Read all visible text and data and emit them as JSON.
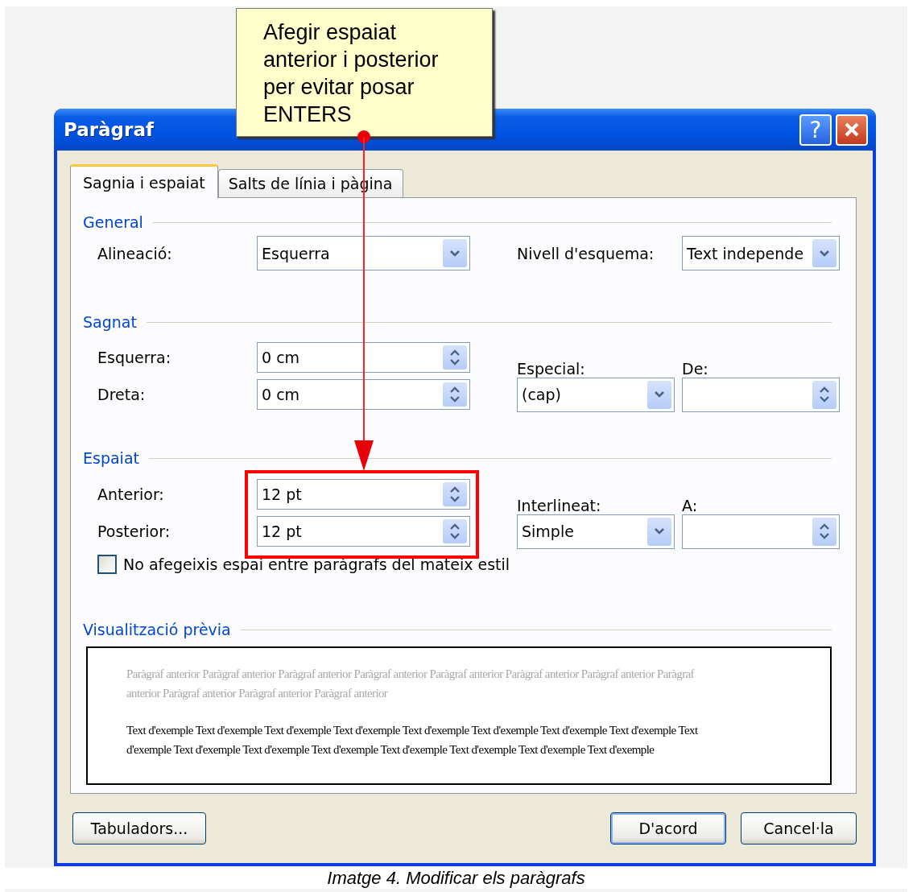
{
  "callout": {
    "lines": [
      "Afegir espaiat",
      "anterior i posterior",
      "per evitar posar",
      "ENTERS"
    ]
  },
  "window": {
    "title": "Paràgraf",
    "help_button": "?"
  },
  "tabs": [
    {
      "label": "Sagnia i espaiat",
      "selected": true
    },
    {
      "label": "Salts de línia i pàgina",
      "selected": false
    }
  ],
  "general": {
    "title": "General",
    "alignment": {
      "label": "Alineació:",
      "value": "Esquerra"
    },
    "outline_level": {
      "label": "Nivell d'esquema:",
      "value": "Text independe"
    }
  },
  "indent": {
    "title": "Sagnat",
    "left": {
      "label": "Esquerra:",
      "value": "0 cm"
    },
    "right": {
      "label": "Dreta:",
      "value": "0 cm"
    },
    "special": {
      "label": "Especial:",
      "value": "(cap)"
    },
    "by": {
      "label": "De:"
    }
  },
  "spacing": {
    "title": "Espaiat",
    "highlighted": true,
    "before": {
      "label": "Anterior:",
      "value": "12 pt"
    },
    "after": {
      "label": "Posterior:",
      "value": "12 pt"
    },
    "line_spacing": {
      "label": "Interlineat:",
      "value": "Simple"
    },
    "at": {
      "label": "A:"
    },
    "no_space_checkbox": {
      "label": "No afegeixis espai entre paràgrafs del mateix estil",
      "checked": false
    }
  },
  "preview": {
    "title": "Visualització prèvia",
    "previous_text": "Paràgraf anterior Paràgraf anterior Paràgraf anterior Paràgraf anterior Paràgraf anterior Paràgraf anterior Paràgraf anterior Paràgraf anterior Paràgraf anterior Paràgraf anterior Paràgraf anterior",
    "sample_text": "Text d'exemple Text d'exemple Text d'exemple Text d'exemple Text d'exemple Text d'exemple Text d'exemple Text d'exemple Text d'exemple Text d'exemple Text d'exemple Text d'exemple Text d'exemple Text d'exemple Text d'exemple Text d'exemple"
  },
  "buttons": {
    "tabs": "Tabuladors...",
    "ok": "D'acord",
    "cancel": "Cancel·la"
  },
  "caption": "Imatge 4. Modificar els paràgrafs"
}
